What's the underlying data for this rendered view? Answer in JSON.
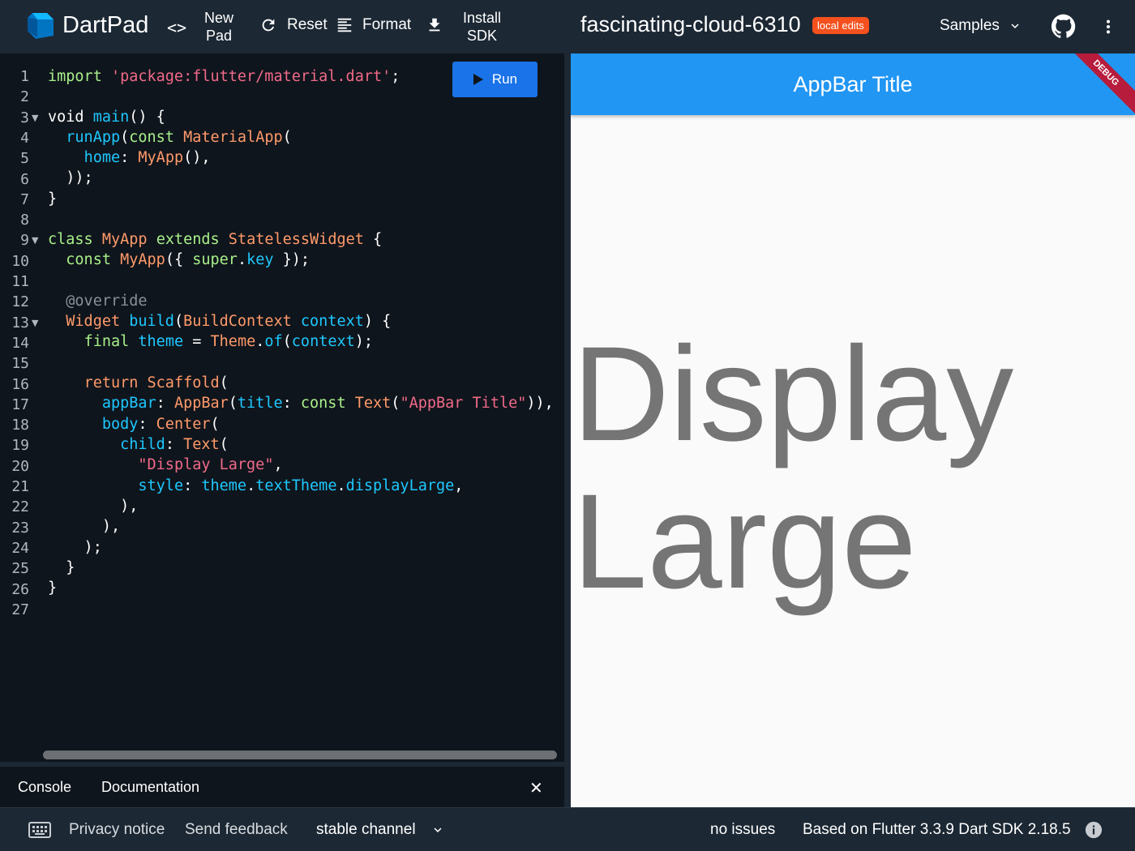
{
  "header": {
    "brand": "DartPad",
    "new_pad_line1": "New",
    "new_pad_line2": "Pad",
    "reset_label": "Reset",
    "format_label": "Format",
    "install_line1": "Install",
    "install_line2": "SDK",
    "pad_title": "fascinating-cloud-6310",
    "badge": "local edits",
    "samples_label": "Samples"
  },
  "editor": {
    "run_label": "Run",
    "line_numbers": [
      "1",
      "2",
      "3",
      "4",
      "5",
      "6",
      "7",
      "8",
      "9",
      "10",
      "11",
      "12",
      "13",
      "14",
      "15",
      "16",
      "17",
      "18",
      "19",
      "20",
      "21",
      "22",
      "23",
      "24",
      "25",
      "26",
      "27"
    ],
    "fold_lines": [
      "3",
      "9",
      "13"
    ]
  },
  "code": {
    "l1a": "import",
    "l1b": " 'package:flutter/material.dart'",
    "l1c": ";",
    "l3a": "void ",
    "l3b": "main",
    "l3c": "() {",
    "l4a": "  ",
    "l4b": "runApp",
    "l4c": "(",
    "l4d": "const",
    "l4e": " ",
    "l4f": "MaterialApp",
    "l4g": "(",
    "l5a": "    ",
    "l5b": "home",
    "l5c": ": ",
    "l5d": "MyApp",
    "l5e": "(),",
    "l6": "  ));",
    "l7": "}",
    "l9a": "class",
    "l9b": " ",
    "l9c": "MyApp",
    "l9d": " ",
    "l9e": "extends",
    "l9f": " ",
    "l9g": "StatelessWidget",
    "l9h": " {",
    "l10a": "  ",
    "l10b": "const",
    "l10c": " ",
    "l10d": "MyApp",
    "l10e": "({ ",
    "l10f": "super",
    "l10g": ".",
    "l10h": "key",
    "l10i": " });",
    "l12": "  @override",
    "l13a": "  ",
    "l13b": "Widget",
    "l13c": " ",
    "l13d": "build",
    "l13e": "(",
    "l13f": "BuildContext",
    "l13g": " ",
    "l13h": "context",
    "l13i": ") {",
    "l14a": "    ",
    "l14b": "final",
    "l14c": " ",
    "l14d": "theme",
    "l14e": " = ",
    "l14f": "Theme",
    "l14g": ".",
    "l14h": "of",
    "l14i": "(",
    "l14j": "context",
    "l14k": ");",
    "l16a": "    ",
    "l16b": "return",
    "l16c": " ",
    "l16d": "Scaffold",
    "l16e": "(",
    "l17a": "      ",
    "l17b": "appBar",
    "l17c": ": ",
    "l17d": "AppBar",
    "l17e": "(",
    "l17f": "title",
    "l17g": ": ",
    "l17h": "const",
    "l17i": " ",
    "l17j": "Text",
    "l17k": "(",
    "l17l": "\"AppBar Title\"",
    "l17m": ")),",
    "l18a": "      ",
    "l18b": "body",
    "l18c": ": ",
    "l18d": "Center",
    "l18e": "(",
    "l19a": "        ",
    "l19b": "child",
    "l19c": ": ",
    "l19d": "Text",
    "l19e": "(",
    "l20a": "          ",
    "l20b": "\"Display Large\"",
    "l20c": ",",
    "l21a": "          ",
    "l21b": "style",
    "l21c": ": ",
    "l21d": "theme",
    "l21e": ".",
    "l21f": "textTheme",
    "l21g": ".",
    "l21h": "displayLarge",
    "l21i": ",",
    "l22": "        ),",
    "l23": "      ),",
    "l24": "    );",
    "l25": "  }",
    "l26": "}"
  },
  "console": {
    "console_tab": "Console",
    "docs_tab": "Documentation",
    "close": "✕"
  },
  "preview": {
    "appbar_title": "AppBar Title",
    "debug_banner": "DEBUG",
    "display_line1": "Display",
    "display_line2": "Large"
  },
  "footer": {
    "privacy": "Privacy notice",
    "feedback": "Send feedback",
    "channel": "stable channel",
    "issues": "no issues",
    "version": "Based on Flutter 3.3.9 Dart SDK 2.18.5"
  },
  "colors": {
    "header_bg": "#1c2834",
    "editor_bg": "#0f151c",
    "run_button": "#1a73e8",
    "appbar": "#2196f3",
    "badge": "#f4511e",
    "debug": "#b71c3c"
  }
}
